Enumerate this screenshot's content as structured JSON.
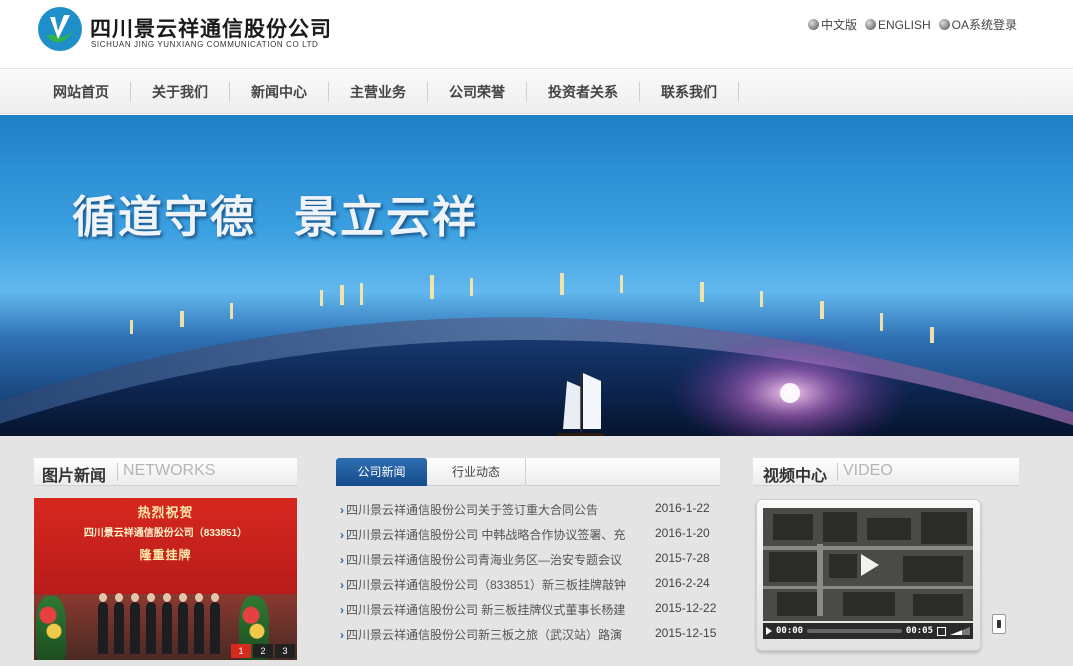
{
  "header": {
    "company_cn": "四川景云祥通信股份公司",
    "company_en": "SICHUAN JING YUNXIANG COMMUNICATION CO LTD",
    "toplinks": [
      "中文版",
      "ENGLISH",
      "OA系统登录"
    ]
  },
  "nav": [
    "网站首页",
    "关于我们",
    "新闻中心",
    "主营业务",
    "公司荣誉",
    "投资者关系",
    "联系我们"
  ],
  "banner": {
    "slogan_1": "循道守德",
    "slogan_2": "景立云祥"
  },
  "photo_news": {
    "title_cn": "图片新闻",
    "title_en": "NETWORKS",
    "image_line_1": "热烈祝贺",
    "image_line_2": "四川景云祥通信股份公司（833851）",
    "image_line_3": "隆重挂牌",
    "pages": [
      "1",
      "2",
      "3"
    ]
  },
  "news": {
    "tabs": [
      "公司新闻",
      "行业动态"
    ],
    "items": [
      {
        "title": "四川景云祥通信股份公司关于签订重大合同公告",
        "date": "2016-1-22"
      },
      {
        "title": "四川景云祥通信股份公司 中韩战略合作协议签署、充",
        "date": "2016-1-20"
      },
      {
        "title": "四川景云祥通信股份公司青海业务区—治安专题会议",
        "date": "2015-7-28"
      },
      {
        "title": "四川景云祥通信股份公司（833851）新三板挂牌敲钟",
        "date": "2016-2-24"
      },
      {
        "title": "四川景云祥通信股份公司 新三板挂牌仪式董事长杨建",
        "date": "2015-12-22"
      },
      {
        "title": "四川景云祥通信股份公司新三板之旅（武汉站）路演",
        "date": "2015-12-15"
      }
    ]
  },
  "video": {
    "title_cn": "视频中心",
    "title_en": "VIDEO",
    "time_current": "00:00",
    "time_total": "00:05"
  },
  "icons": {
    "language_icon": "globe-icon",
    "video_play": "play-icon",
    "fullscreen": "fullscreen-icon",
    "volume": "volume-icon"
  }
}
